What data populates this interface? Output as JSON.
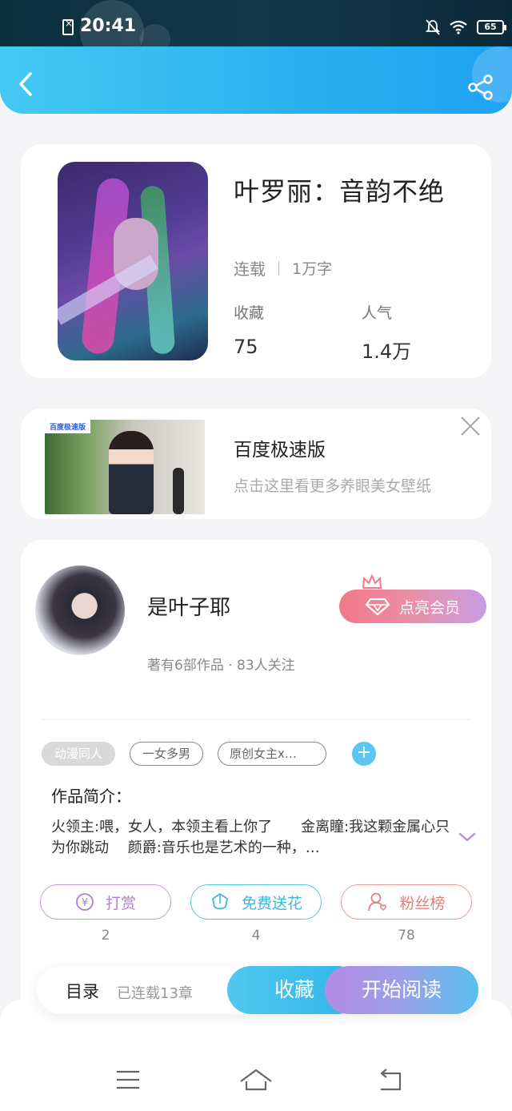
{
  "status_bar": {
    "time": "20:41",
    "battery": "65",
    "icons": [
      "sim-off-icon",
      "bell-off-icon",
      "wifi-icon",
      "battery-icon"
    ]
  },
  "header": {
    "back_icon": "chevron-left-icon",
    "share_icon": "share-icon"
  },
  "book": {
    "title": "叶罗丽：音韵不绝",
    "status": "连载",
    "words": "1万字",
    "fav_label": "收藏",
    "fav_value": "75",
    "pop_label": "人气",
    "pop_value": "1.4万"
  },
  "ad": {
    "logo_text": "百度极速版",
    "title": "百度极速版",
    "subtitle": "点击这里看更多养眼美女壁纸",
    "close_icon": "close-icon"
  },
  "author": {
    "name": "是叶子耶",
    "stats": "著有6部作品 · 83人关注",
    "vip_button": "点亮会员",
    "tags": [
      "动漫同人",
      "一女多男",
      "原创女主x…"
    ],
    "intro_label": "作品简介：",
    "intro_text": "火领主:喂，女人，本领主看上你了　　金离瞳:我这颗金属心只为你跳动　 颜爵:音乐也是艺术的一种，…",
    "actions": [
      {
        "label": "打赏",
        "count": "2",
        "icon": "coin-icon"
      },
      {
        "label": "免费送花",
        "count": "4",
        "icon": "flower-icon"
      },
      {
        "label": "粉丝榜",
        "count": "78",
        "icon": "fans-icon"
      }
    ]
  },
  "bottom_bar": {
    "toc_label": "目录",
    "toc_sub": "已连载13章",
    "fav_button": "收藏",
    "read_button": "开始阅读"
  },
  "colors": {
    "header_accent": "#2ab0ef",
    "vip_gradient_start": "#f07a8a",
    "read_gradient_start": "#b48be6"
  }
}
